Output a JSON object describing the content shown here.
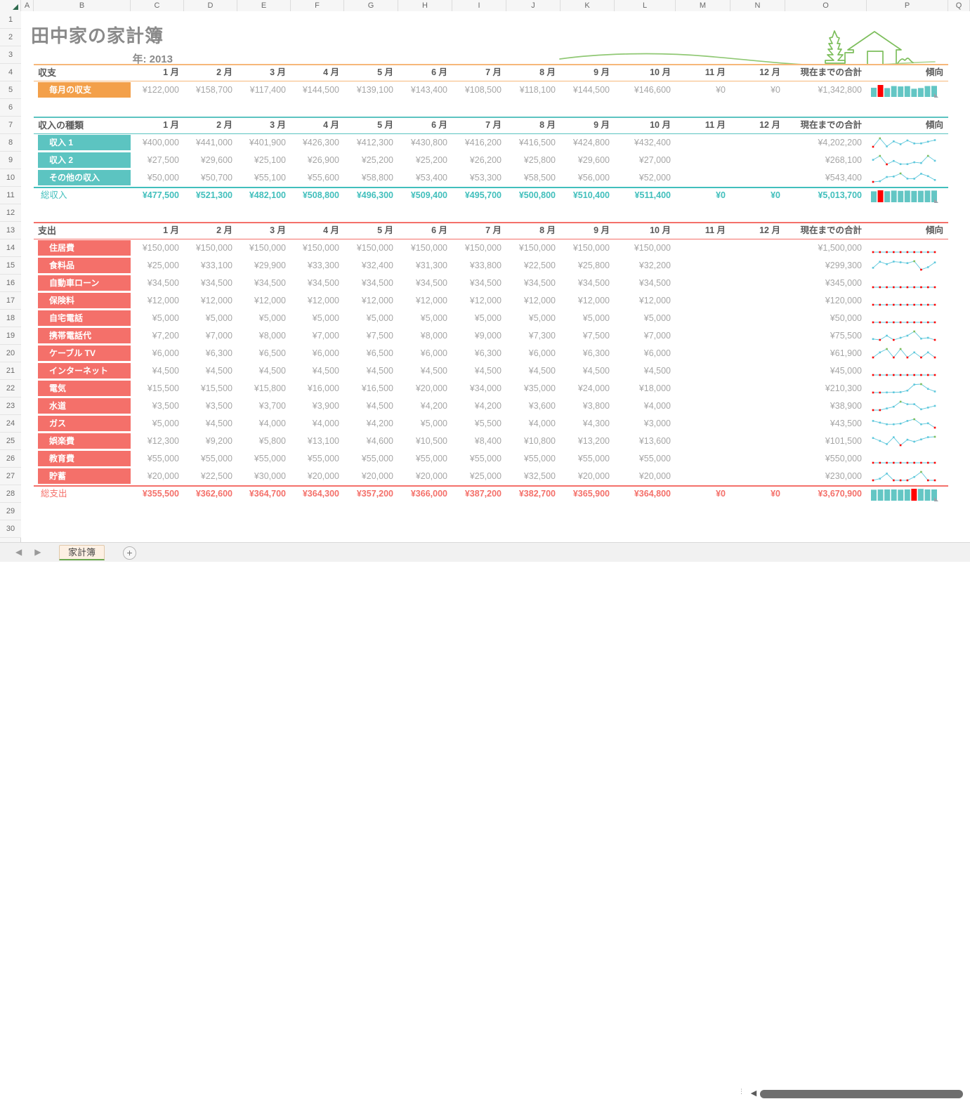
{
  "window": {
    "column_letters": [
      "A",
      "B",
      "C",
      "D",
      "E",
      "F",
      "G",
      "H",
      "I",
      "J",
      "K",
      "L",
      "M",
      "N",
      "O",
      "P",
      "Q"
    ],
    "row_numbers": [
      "1",
      "2",
      "3",
      "4",
      "5",
      "6",
      "7",
      "8",
      "9",
      "10",
      "11",
      "12",
      "13",
      "14",
      "15",
      "16",
      "17",
      "18",
      "19",
      "20",
      "21",
      "22",
      "23",
      "24",
      "25",
      "26",
      "27",
      "28",
      "29",
      "30"
    ]
  },
  "header": {
    "title": "田中家の家計簿",
    "year_label": "年: 2013",
    "decoration": "house-and-tree-line-art"
  },
  "colors": {
    "orange": "#F3A04A",
    "orange_rule": "#F6B87A",
    "teal": "#5CC4C1",
    "teal_text": "#41BFBC",
    "red": "#F4706A",
    "red_text": "#F4706A",
    "value_gray": "#A6A6A6",
    "header_gray": "#595959",
    "sparkline_blue": "#5FC8DC",
    "sparkline_marker_red": "#FF0000",
    "decor_green": "#7DBE5C"
  },
  "months": [
    "1 月",
    "2 月",
    "3 月",
    "4 月",
    "5 月",
    "6 月",
    "7 月",
    "8 月",
    "9 月",
    "10 月",
    "11 月",
    "12 月"
  ],
  "labels": {
    "total_to_date": "現在までの合計",
    "trend": "傾向"
  },
  "chart_data": {
    "type": "table",
    "title": "田中家の家計簿",
    "subtitle": "年: 2013",
    "categories": [
      "1 月",
      "2 月",
      "3 月",
      "4 月",
      "5 月",
      "6 月",
      "7 月",
      "8 月",
      "9 月",
      "10 月",
      "11 月",
      "12 月"
    ],
    "sections": [
      {
        "key": "balance",
        "title": "収支",
        "accent": "#F3A04A",
        "rows": [
          {
            "label": "毎月の収支",
            "values": [
              "¥122,000",
              "¥158,700",
              "¥117,400",
              "¥144,500",
              "¥139,100",
              "¥143,400",
              "¥108,500",
              "¥118,100",
              "¥144,500",
              "¥146,600",
              "¥0",
              "¥0"
            ],
            "numeric": [
              122000,
              158700,
              117400,
              144500,
              139100,
              143400,
              108500,
              118100,
              144500,
              146600,
              0,
              0
            ],
            "total": "¥1,342,800",
            "sparkline": "column"
          }
        ]
      },
      {
        "key": "income",
        "title": "収入の種類",
        "accent": "#5CC4C1",
        "rows": [
          {
            "label": "収入 1",
            "values": [
              "¥400,000",
              "¥441,000",
              "¥401,900",
              "¥426,300",
              "¥412,300",
              "¥430,800",
              "¥416,200",
              "¥416,500",
              "¥424,800",
              "¥432,400",
              "",
              ""
            ],
            "numeric": [
              400000,
              441000,
              401900,
              426300,
              412300,
              430800,
              416200,
              416500,
              424800,
              432400
            ],
            "total": "¥4,202,200",
            "sparkline": "line"
          },
          {
            "label": "収入 2",
            "values": [
              "¥27,500",
              "¥29,600",
              "¥25,100",
              "¥26,900",
              "¥25,200",
              "¥25,200",
              "¥26,200",
              "¥25,800",
              "¥29,600",
              "¥27,000",
              "",
              ""
            ],
            "numeric": [
              27500,
              29600,
              25100,
              26900,
              25200,
              25200,
              26200,
              25800,
              29600,
              27000
            ],
            "total": "¥268,100",
            "sparkline": "line"
          },
          {
            "label": "その他の収入",
            "values": [
              "¥50,000",
              "¥50,700",
              "¥55,100",
              "¥55,600",
              "¥58,800",
              "¥53,400",
              "¥53,300",
              "¥58,500",
              "¥56,000",
              "¥52,000",
              "",
              ""
            ],
            "numeric": [
              50000,
              50700,
              55100,
              55600,
              58800,
              53400,
              53300,
              58500,
              56000,
              52000
            ],
            "total": "¥543,400",
            "sparkline": "line"
          }
        ],
        "total_row": {
          "label": "総収入",
          "values": [
            "¥477,500",
            "¥521,300",
            "¥482,100",
            "¥508,800",
            "¥496,300",
            "¥509,400",
            "¥495,700",
            "¥500,800",
            "¥510,400",
            "¥511,400",
            "¥0",
            "¥0"
          ],
          "numeric": [
            477500,
            521300,
            482100,
            508800,
            496300,
            509400,
            495700,
            500800,
            510400,
            511400,
            0,
            0
          ],
          "total": "¥5,013,700",
          "sparkline": "column"
        }
      },
      {
        "key": "expenses",
        "title": "支出",
        "accent": "#F4706A",
        "rows": [
          {
            "label": "住居費",
            "values": [
              "¥150,000",
              "¥150,000",
              "¥150,000",
              "¥150,000",
              "¥150,000",
              "¥150,000",
              "¥150,000",
              "¥150,000",
              "¥150,000",
              "¥150,000",
              "",
              ""
            ],
            "numeric": [
              150000,
              150000,
              150000,
              150000,
              150000,
              150000,
              150000,
              150000,
              150000,
              150000
            ],
            "total": "¥1,500,000",
            "sparkline": "line"
          },
          {
            "label": "食料品",
            "values": [
              "¥25,000",
              "¥33,100",
              "¥29,900",
              "¥33,300",
              "¥32,400",
              "¥31,300",
              "¥33,800",
              "¥22,500",
              "¥25,800",
              "¥32,200",
              "",
              ""
            ],
            "numeric": [
              25000,
              33100,
              29900,
              33300,
              32400,
              31300,
              33800,
              22500,
              25800,
              32200
            ],
            "total": "¥299,300",
            "sparkline": "line"
          },
          {
            "label": "自動車ローン",
            "values": [
              "¥34,500",
              "¥34,500",
              "¥34,500",
              "¥34,500",
              "¥34,500",
              "¥34,500",
              "¥34,500",
              "¥34,500",
              "¥34,500",
              "¥34,500",
              "",
              ""
            ],
            "numeric": [
              34500,
              34500,
              34500,
              34500,
              34500,
              34500,
              34500,
              34500,
              34500,
              34500
            ],
            "total": "¥345,000",
            "sparkline": "line"
          },
          {
            "label": "保険料",
            "values": [
              "¥12,000",
              "¥12,000",
              "¥12,000",
              "¥12,000",
              "¥12,000",
              "¥12,000",
              "¥12,000",
              "¥12,000",
              "¥12,000",
              "¥12,000",
              "",
              ""
            ],
            "numeric": [
              12000,
              12000,
              12000,
              12000,
              12000,
              12000,
              12000,
              12000,
              12000,
              12000
            ],
            "total": "¥120,000",
            "sparkline": "line"
          },
          {
            "label": "自宅電話",
            "values": [
              "¥5,000",
              "¥5,000",
              "¥5,000",
              "¥5,000",
              "¥5,000",
              "¥5,000",
              "¥5,000",
              "¥5,000",
              "¥5,000",
              "¥5,000",
              "",
              ""
            ],
            "numeric": [
              5000,
              5000,
              5000,
              5000,
              5000,
              5000,
              5000,
              5000,
              5000,
              5000
            ],
            "total": "¥50,000",
            "sparkline": "line"
          },
          {
            "label": "携帯電話代",
            "values": [
              "¥7,200",
              "¥7,000",
              "¥8,000",
              "¥7,000",
              "¥7,500",
              "¥8,000",
              "¥9,000",
              "¥7,300",
              "¥7,500",
              "¥7,000",
              "",
              ""
            ],
            "numeric": [
              7200,
              7000,
              8000,
              7000,
              7500,
              8000,
              9000,
              7300,
              7500,
              7000
            ],
            "total": "¥75,500",
            "sparkline": "line"
          },
          {
            "label": "ケーブル TV",
            "values": [
              "¥6,000",
              "¥6,300",
              "¥6,500",
              "¥6,000",
              "¥6,500",
              "¥6,000",
              "¥6,300",
              "¥6,000",
              "¥6,300",
              "¥6,000",
              "",
              ""
            ],
            "numeric": [
              6000,
              6300,
              6500,
              6000,
              6500,
              6000,
              6300,
              6000,
              6300,
              6000
            ],
            "total": "¥61,900",
            "sparkline": "line"
          },
          {
            "label": "インターネット",
            "values": [
              "¥4,500",
              "¥4,500",
              "¥4,500",
              "¥4,500",
              "¥4,500",
              "¥4,500",
              "¥4,500",
              "¥4,500",
              "¥4,500",
              "¥4,500",
              "",
              ""
            ],
            "numeric": [
              4500,
              4500,
              4500,
              4500,
              4500,
              4500,
              4500,
              4500,
              4500,
              4500
            ],
            "total": "¥45,000",
            "sparkline": "line"
          },
          {
            "label": "電気",
            "values": [
              "¥15,500",
              "¥15,500",
              "¥15,800",
              "¥16,000",
              "¥16,500",
              "¥20,000",
              "¥34,000",
              "¥35,000",
              "¥24,000",
              "¥18,000",
              "",
              ""
            ],
            "numeric": [
              15500,
              15500,
              15800,
              16000,
              16500,
              20000,
              34000,
              35000,
              24000,
              18000
            ],
            "total": "¥210,300",
            "sparkline": "line"
          },
          {
            "label": "水道",
            "values": [
              "¥3,500",
              "¥3,500",
              "¥3,700",
              "¥3,900",
              "¥4,500",
              "¥4,200",
              "¥4,200",
              "¥3,600",
              "¥3,800",
              "¥4,000",
              "",
              ""
            ],
            "numeric": [
              3500,
              3500,
              3700,
              3900,
              4500,
              4200,
              4200,
              3600,
              3800,
              4000
            ],
            "total": "¥38,900",
            "sparkline": "line"
          },
          {
            "label": "ガス",
            "values": [
              "¥5,000",
              "¥4,500",
              "¥4,000",
              "¥4,000",
              "¥4,200",
              "¥5,000",
              "¥5,500",
              "¥4,000",
              "¥4,300",
              "¥3,000",
              "",
              ""
            ],
            "numeric": [
              5000,
              4500,
              4000,
              4000,
              4200,
              5000,
              5500,
              4000,
              4300,
              3000
            ],
            "total": "¥43,500",
            "sparkline": "line"
          },
          {
            "label": "娯楽費",
            "values": [
              "¥12,300",
              "¥9,200",
              "¥5,800",
              "¥13,100",
              "¥4,600",
              "¥10,500",
              "¥8,400",
              "¥10,800",
              "¥13,200",
              "¥13,600",
              "",
              ""
            ],
            "numeric": [
              12300,
              9200,
              5800,
              13100,
              4600,
              10500,
              8400,
              10800,
              13200,
              13600
            ],
            "total": "¥101,500",
            "sparkline": "line"
          },
          {
            "label": "教育費",
            "values": [
              "¥55,000",
              "¥55,000",
              "¥55,000",
              "¥55,000",
              "¥55,000",
              "¥55,000",
              "¥55,000",
              "¥55,000",
              "¥55,000",
              "¥55,000",
              "",
              ""
            ],
            "numeric": [
              55000,
              55000,
              55000,
              55000,
              55000,
              55000,
              55000,
              55000,
              55000,
              55000
            ],
            "total": "¥550,000",
            "sparkline": "line"
          },
          {
            "label": "貯蓄",
            "values": [
              "¥20,000",
              "¥22,500",
              "¥30,000",
              "¥20,000",
              "¥20,000",
              "¥20,000",
              "¥25,000",
              "¥32,500",
              "¥20,000",
              "¥20,000",
              "",
              ""
            ],
            "numeric": [
              20000,
              22500,
              30000,
              20000,
              20000,
              20000,
              25000,
              32500,
              20000,
              20000
            ],
            "total": "¥230,000",
            "sparkline": "line"
          }
        ],
        "total_row": {
          "label": "総支出",
          "values": [
            "¥355,500",
            "¥362,600",
            "¥364,700",
            "¥364,300",
            "¥357,200",
            "¥366,000",
            "¥387,200",
            "¥382,700",
            "¥365,900",
            "¥364,800",
            "¥0",
            "¥0"
          ],
          "numeric": [
            355500,
            362600,
            364700,
            364300,
            357200,
            366000,
            387200,
            382700,
            365900,
            364800,
            0,
            0
          ],
          "total": "¥3,670,900",
          "sparkline": "column"
        }
      }
    ]
  },
  "tabbar": {
    "prev_arrow": "◀",
    "next_arrow": "▶",
    "sheet_name": "家計簿",
    "add_sheet": "+",
    "scroll_left_arrow": "◀"
  }
}
